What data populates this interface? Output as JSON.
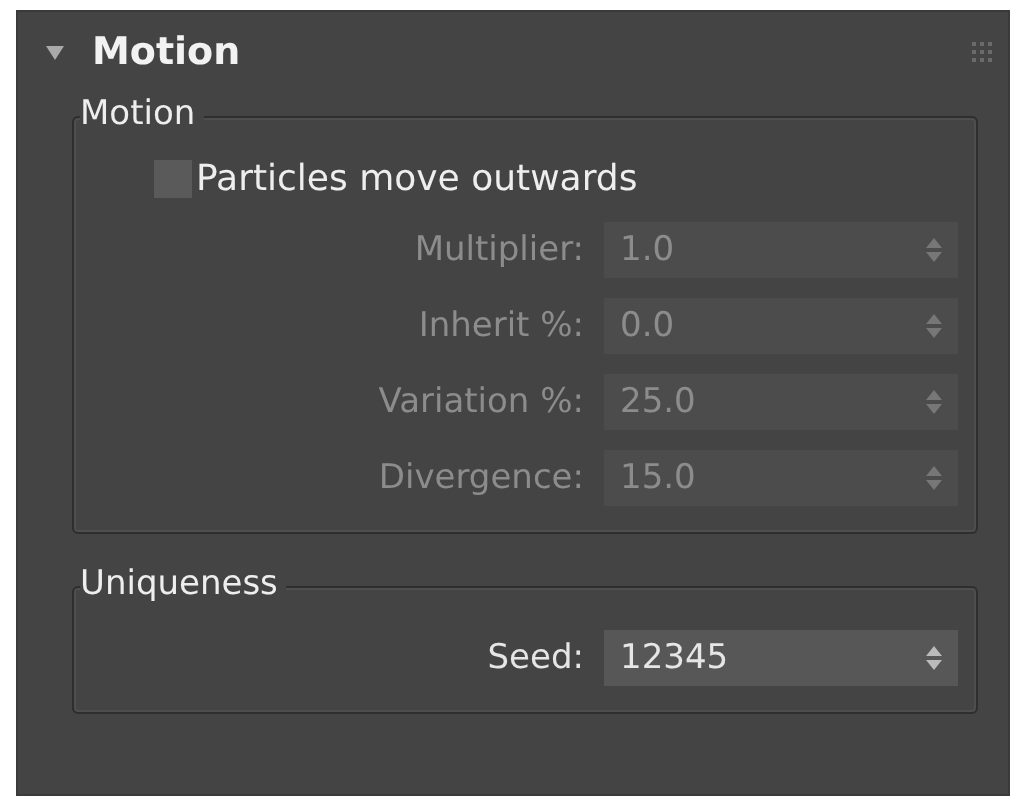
{
  "rollout": {
    "title": "Motion",
    "expanded": true
  },
  "groups": [
    {
      "title": "Motion",
      "checkbox": {
        "label": "Particles move outwards",
        "checked": false
      },
      "spinners": [
        {
          "label": "Multiplier:",
          "value": "1.0",
          "disabled": true
        },
        {
          "label": "Inherit %:",
          "value": "0.0",
          "disabled": true
        },
        {
          "label": "Variation %:",
          "value": "25.0",
          "disabled": true
        },
        {
          "label": "Divergence:",
          "value": "15.0",
          "disabled": true
        }
      ]
    },
    {
      "title": "Uniqueness",
      "spinners": [
        {
          "label": "Seed:",
          "value": "12345",
          "disabled": false
        }
      ]
    }
  ]
}
